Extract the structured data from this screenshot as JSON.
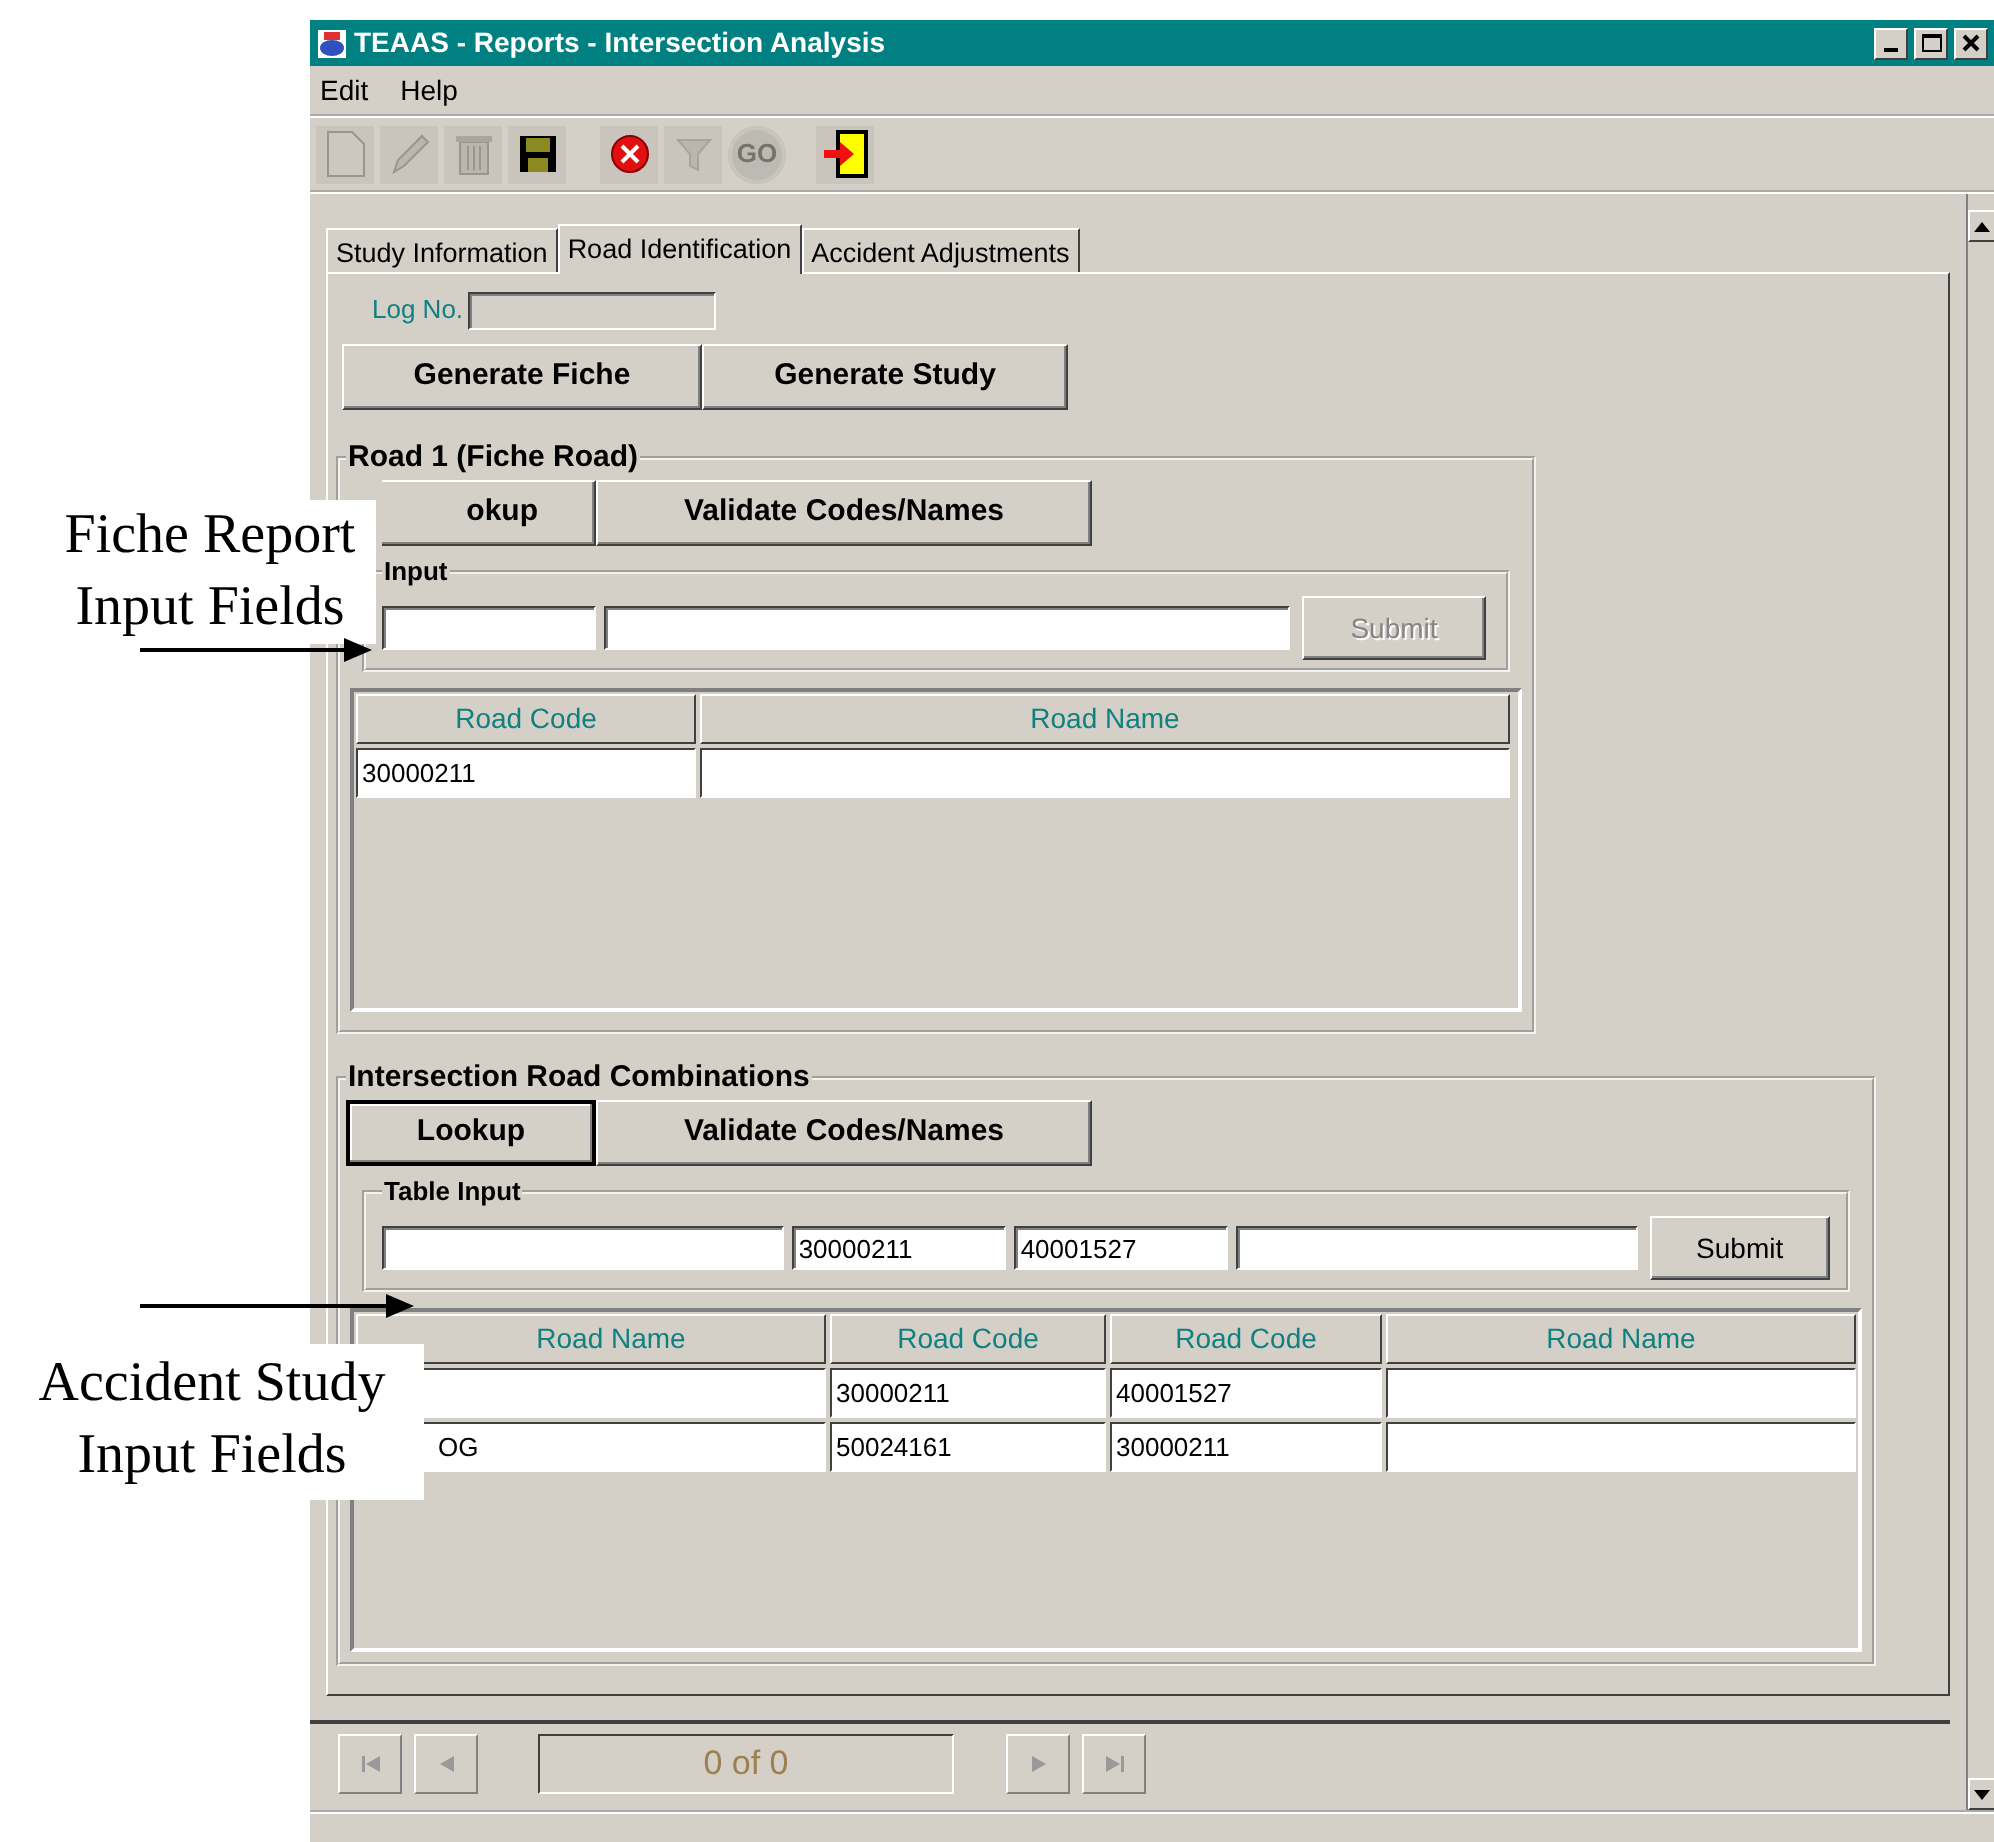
{
  "window": {
    "title": "TEAAS - Reports - Intersection Analysis"
  },
  "menu": [
    {
      "label": "Edit"
    },
    {
      "label": "Help"
    }
  ],
  "toolbar": [
    {
      "kind": "new",
      "disabled": true
    },
    {
      "kind": "edit",
      "disabled": true
    },
    {
      "kind": "delete",
      "disabled": true
    },
    {
      "kind": "save",
      "disabled": false
    },
    {
      "kind": "cancel",
      "disabled": false
    },
    {
      "kind": "filter",
      "disabled": true
    },
    {
      "kind": "go",
      "label": "GO",
      "disabled": true
    },
    {
      "kind": "exit",
      "disabled": false
    }
  ],
  "tabs": [
    {
      "label": "Study Information",
      "selected": false
    },
    {
      "label": "Road Identification",
      "selected": true
    },
    {
      "label": "Accident Adjustments",
      "selected": false
    }
  ],
  "log_no": {
    "label": "Log No."
  },
  "actions": [
    {
      "label": "Generate Fiche"
    },
    {
      "label": "Generate Study"
    }
  ],
  "groups": [
    {
      "title": "Road 1 (Fiche Road)",
      "buttons": [
        {
          "label": "okup",
          "default": false,
          "clipped_left": true
        },
        {
          "label": "Validate Codes/Names",
          "default": false,
          "clipped_left": false
        }
      ],
      "table_input": {
        "title": "Input",
        "fields": [
          {
            "kind": "text"
          },
          {
            "kind": "text"
          }
        ],
        "submit": {
          "label": "Submit",
          "disabled": true
        }
      },
      "table": {
        "columns": [
          {
            "label": "Road Code",
            "clipped_left": false
          },
          {
            "label": "Road Name",
            "clipped_left": false
          }
        ],
        "rows": [
          [
            "30000211",
            ""
          ]
        ]
      }
    },
    {
      "title": "Intersection Road Combinations",
      "buttons": [
        {
          "label": "Lookup",
          "default": true,
          "clipped_left": false
        },
        {
          "label": "Validate Codes/Names",
          "default": false,
          "clipped_left": false
        }
      ],
      "table_input": {
        "title": "Table Input",
        "fields": [
          {
            "kind": "text"
          },
          {
            "kind": "text",
            "value": "30000211"
          },
          {
            "kind": "text",
            "value": "40001527"
          },
          {
            "kind": "text"
          }
        ],
        "submit": {
          "label": "Submit",
          "disabled": false
        }
      },
      "table": {
        "columns": [
          {
            "label": "Road Name",
            "clipped_left": true
          },
          {
            "label": "Road Code",
            "clipped_left": false
          },
          {
            "label": "Road Code",
            "clipped_left": false
          },
          {
            "label": "Road Name",
            "clipped_left": false
          }
        ],
        "rows": [
          [
            "",
            "30000211",
            "40001527",
            ""
          ],
          [
            "OG",
            "50024161",
            "30000211",
            ""
          ]
        ]
      }
    }
  ],
  "pager": {
    "buttons": [
      {
        "kind": "first",
        "disabled": true
      },
      {
        "kind": "prev",
        "disabled": true
      },
      {
        "kind": "next",
        "disabled": true
      },
      {
        "kind": "last",
        "disabled": true
      }
    ],
    "display": "0 of 0"
  },
  "annotations": [
    {
      "text": "Fiche Report\nInput Fields"
    },
    {
      "text": "Accident Study\nInput Fields"
    }
  ]
}
